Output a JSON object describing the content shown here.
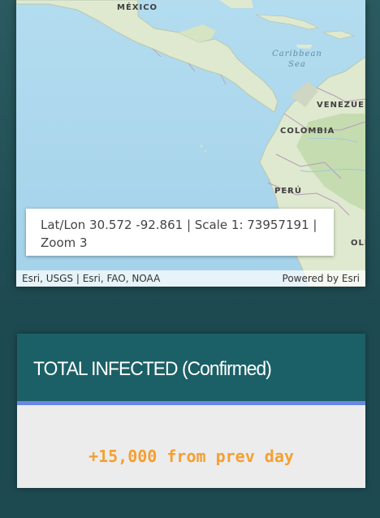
{
  "map": {
    "labels": {
      "mexico": "MÉXICO",
      "caribbean_sea": "Caribbean Sea",
      "venezuela": "VENEZUEL",
      "colombia": "COLOMBIA",
      "peru": "PERÚ",
      "bolivia_partial": "OLI"
    },
    "coordinates_text": "Lat/Lon 30.572 -92.861 | Scale 1: 73957191 | Zoom 3",
    "attribution_left": "Esri, USGS | Esri, FAO, NOAA",
    "attribution_right": "Powered by Esri",
    "colors": {
      "ocean": "#a9d6ec",
      "land": "#dfe9cf",
      "forest": "#c5dcb0"
    }
  },
  "stat_card": {
    "title": "TOTAL INFECTED (Confirmed)",
    "change_text": "+15,000 from prev day",
    "colors": {
      "header": "#1b6066",
      "accent_bar": "#6b86e8",
      "change": "#f4a033"
    }
  }
}
